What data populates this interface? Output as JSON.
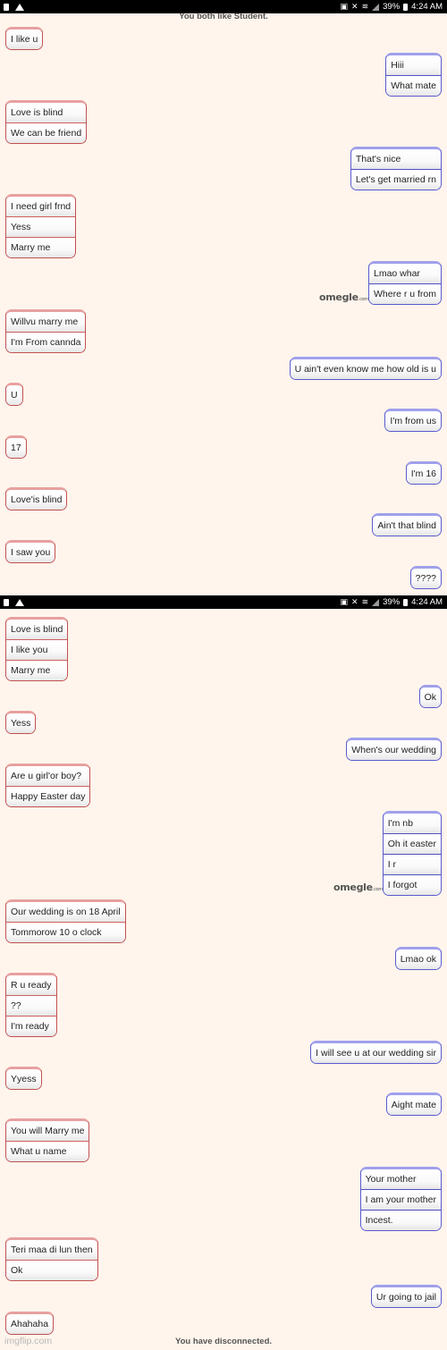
{
  "status_bar": {
    "left_icons": [
      "document-icon",
      "warning-icon"
    ],
    "right_icons": [
      "sim-icon",
      "mute-icon",
      "wifi-icon",
      "signal-icon"
    ],
    "battery": "39%",
    "time": "4:24 AM"
  },
  "system_messages": {
    "common_interest": "You both like Student.",
    "disconnected": "You have disconnected."
  },
  "logo": {
    "name": "omegle",
    "suffix": ".com"
  },
  "watermark": "imgflip.com",
  "colors": {
    "background": "#fff5ec",
    "stranger_border": "#c45050",
    "you_border": "#5a5ad0"
  },
  "screen1": {
    "messages": [
      {
        "sender": "stranger",
        "lines": [
          "I like u"
        ]
      },
      {
        "sender": "you",
        "lines": [
          "Hiii",
          "What mate"
        ]
      },
      {
        "sender": "stranger",
        "lines": [
          "Love is blind",
          "We can be friend"
        ]
      },
      {
        "sender": "you",
        "lines": [
          "That's nice",
          "Let's get married rn"
        ]
      },
      {
        "sender": "stranger",
        "lines": [
          "I need girl frnd",
          "Yess",
          "Marry me"
        ]
      },
      {
        "sender": "you",
        "lines": [
          "Lmao whar",
          "Where r u from"
        ]
      },
      {
        "sender": "stranger",
        "lines": [
          "Willvu marry me",
          "I'm From cannda"
        ]
      },
      {
        "sender": "you",
        "lines": [
          "U ain't even know me how old is u"
        ]
      },
      {
        "sender": "stranger",
        "lines": [
          "U"
        ]
      },
      {
        "sender": "you",
        "lines": [
          "I'm from us"
        ]
      },
      {
        "sender": "stranger",
        "lines": [
          "17"
        ]
      },
      {
        "sender": "you",
        "lines": [
          "I'm 16"
        ]
      },
      {
        "sender": "stranger",
        "lines": [
          "Love'is blind"
        ]
      },
      {
        "sender": "you",
        "lines": [
          "Ain't that blind"
        ]
      },
      {
        "sender": "stranger",
        "lines": [
          "I saw you"
        ]
      },
      {
        "sender": "you",
        "lines": [
          "????"
        ]
      }
    ]
  },
  "screen2": {
    "messages": [
      {
        "sender": "stranger",
        "lines": [
          "Love is blind",
          "I like you",
          "Marry me"
        ]
      },
      {
        "sender": "you",
        "lines": [
          "Ok"
        ]
      },
      {
        "sender": "stranger",
        "lines": [
          "Yess"
        ]
      },
      {
        "sender": "you",
        "lines": [
          "When's our wedding"
        ]
      },
      {
        "sender": "stranger",
        "lines": [
          "Are u girl'or boy?",
          "Happy Easter day"
        ]
      },
      {
        "sender": "you",
        "lines": [
          "I'm nb",
          "Oh it easter",
          "I r",
          "I forgot"
        ]
      },
      {
        "sender": "stranger",
        "lines": [
          "Our wedding is on 18 April",
          "Tommorow 10 o clock"
        ]
      },
      {
        "sender": "you",
        "lines": [
          "Lmao ok"
        ]
      },
      {
        "sender": "stranger",
        "lines": [
          "R u ready",
          "??",
          "I'm ready"
        ]
      },
      {
        "sender": "you",
        "lines": [
          "I will see u at our wedding sir"
        ]
      },
      {
        "sender": "stranger",
        "lines": [
          "Yyess"
        ]
      },
      {
        "sender": "you",
        "lines": [
          "Aight mate"
        ]
      },
      {
        "sender": "stranger",
        "lines": [
          "You will Marry me",
          "What u name"
        ]
      },
      {
        "sender": "you",
        "lines": [
          "Your mother",
          "I am your mother",
          "Incest."
        ]
      },
      {
        "sender": "stranger",
        "lines": [
          "Teri maa di lun then",
          "Ok"
        ]
      },
      {
        "sender": "you",
        "lines": [
          "Ur going to jail"
        ]
      },
      {
        "sender": "stranger",
        "lines": [
          "Ahahaha"
        ]
      }
    ]
  }
}
